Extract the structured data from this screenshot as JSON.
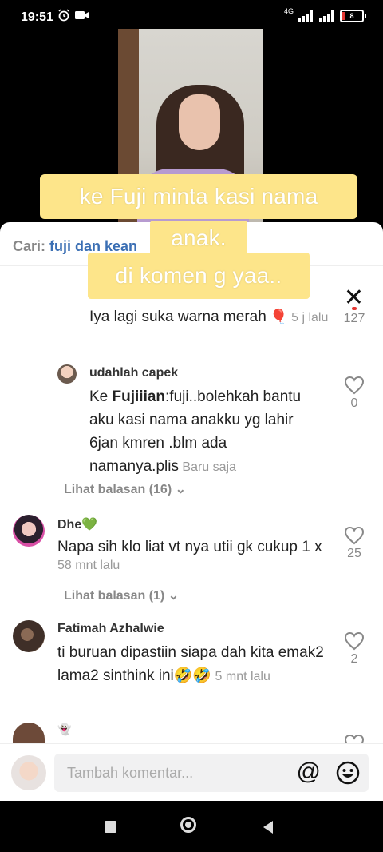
{
  "status": {
    "time": "19:51",
    "network_type": "4G",
    "battery_level": "8"
  },
  "video": {
    "caption_line1": "ke Fuji minta kasi nama",
    "caption_line2": "anak.",
    "caption_line3": "di komen g yaa.."
  },
  "search": {
    "label": "Cari:",
    "term": "fuji dan kean"
  },
  "comments": [
    {
      "text": "Iya lagi suka warna merah",
      "time": "5 j lalu",
      "likes": "127"
    },
    {
      "author": "udahlah capek",
      "reply_to": "Fujiiian",
      "text": ":fuji..bolehkah bantu aku kasi nama anakku yg lahir 6jan kmren .blm ada namanya.plis",
      "time": "Baru saja",
      "likes": "0",
      "view_replies": "Lihat balasan (16)"
    },
    {
      "author": "Dhe💚",
      "text": "Napa sih klo liat vt nya utii gk cukup 1 x",
      "time": "58 mnt lalu",
      "likes": "25",
      "view_replies": "Lihat balasan (1)"
    },
    {
      "author": "Fatimah Azhalwie",
      "text": "ti buruan dipastiin siapa dah kita emak2 lama2 sinthink ini🤣🤣",
      "time": "5 mnt lalu",
      "likes": "2"
    },
    {
      "author": "👻"
    }
  ],
  "composer": {
    "placeholder": "Tambah komentar...",
    "ke_prefix": "Ke "
  },
  "icons": {
    "close": "close-icon",
    "heart": "heart-icon",
    "at": "at-icon",
    "emoji": "emoji-icon"
  },
  "colors": {
    "caption_bg": "#fde58a",
    "link_blue": "#3b6fb4",
    "heart_red": "#e53935"
  }
}
